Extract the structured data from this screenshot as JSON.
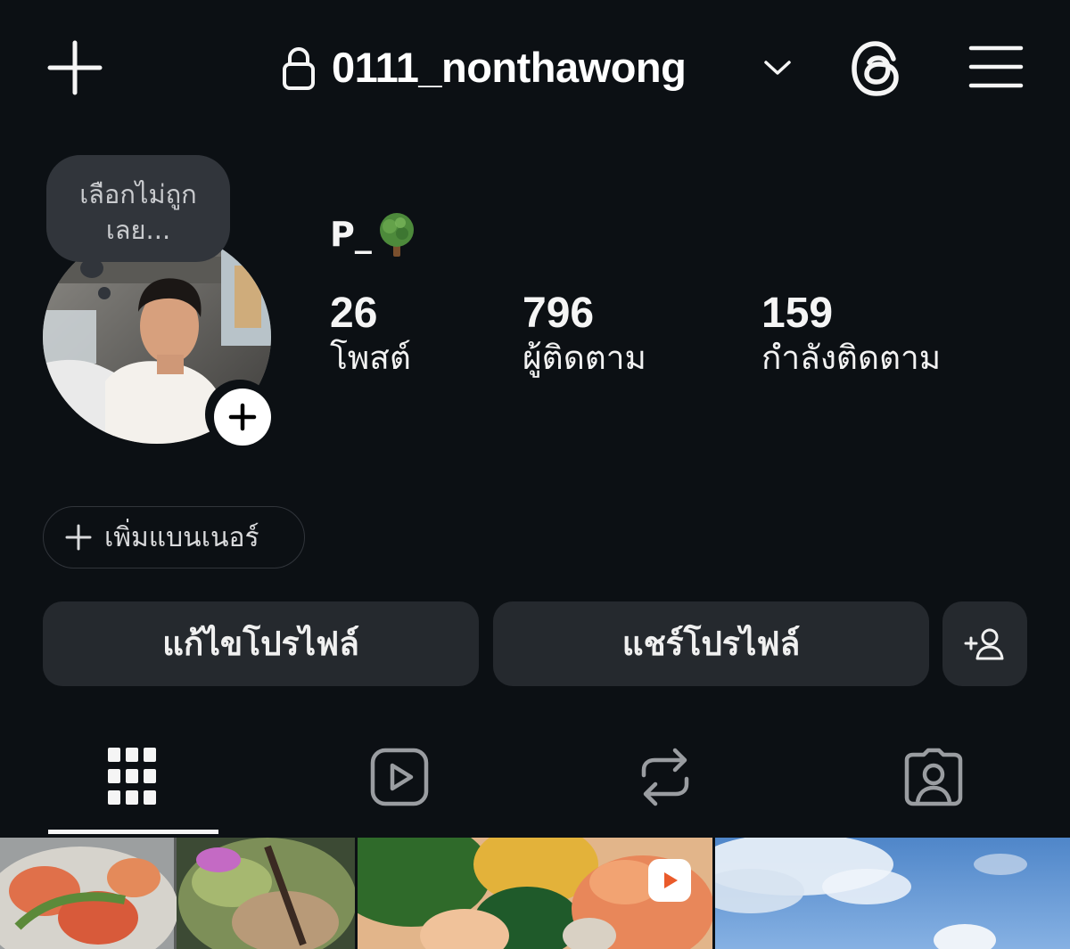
{
  "topbar": {
    "username": "0111_nonthawong",
    "icons": [
      "plus-icon",
      "lock-icon",
      "chevron-down-icon",
      "threads-icon",
      "menu-icon"
    ]
  },
  "profile": {
    "note": "เลือกไม่ถูก เลย...",
    "display_name": "P_",
    "display_name_emoji": "tree-emoji",
    "stats": {
      "posts": {
        "value": "26",
        "label": "โพสต์"
      },
      "followers": {
        "value": "796",
        "label": "ผู้ติดตาม"
      },
      "following": {
        "value": "159",
        "label": "กำลังติดตาม"
      }
    }
  },
  "banner": {
    "label": "เพิ่มแบนเนอร์"
  },
  "actions": {
    "edit_profile": "แก้ไขโปรไฟล์",
    "share_profile": "แชร์โปรไฟล์",
    "add_person_icon": "add-person-icon"
  },
  "tabs": [
    {
      "name": "posts",
      "icon": "grid-icon",
      "active": true
    },
    {
      "name": "reels",
      "icon": "reels-icon",
      "active": false
    },
    {
      "name": "reposts",
      "icon": "repost-icon",
      "active": false
    },
    {
      "name": "tagged",
      "icon": "tagged-icon",
      "active": false
    }
  ],
  "grid": [
    {
      "kind": "photo",
      "subject": "seafood salad"
    },
    {
      "kind": "reel",
      "subject": "shrimp and greens dish"
    },
    {
      "kind": "photo",
      "subject": "blue sky with clouds"
    }
  ],
  "colors": {
    "background": "#0c1014",
    "button": "#25292e",
    "bubble": "#31353b",
    "text": "#f5f5f5"
  }
}
